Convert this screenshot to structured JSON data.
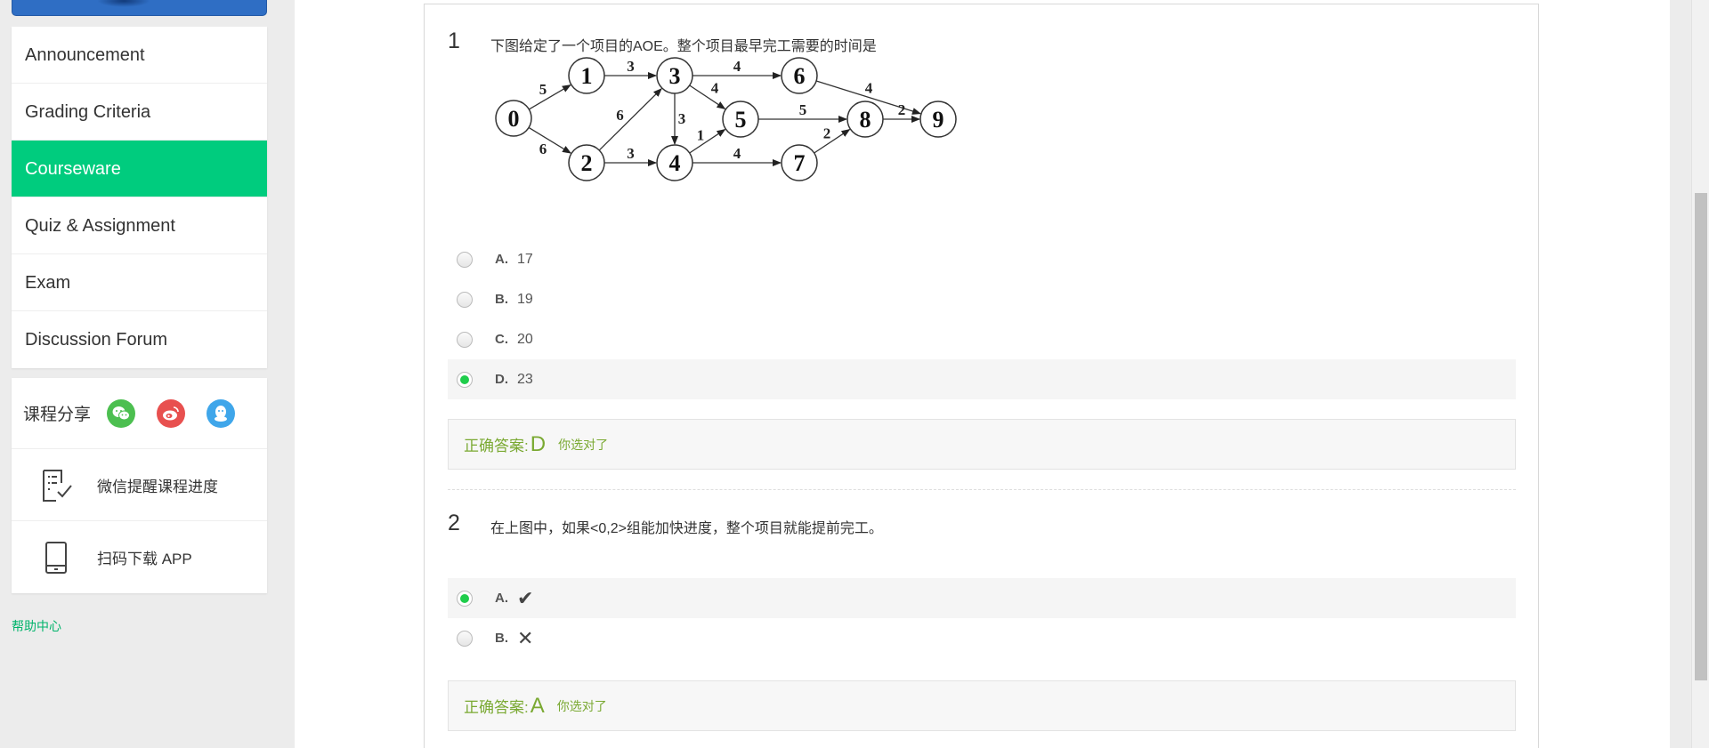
{
  "sidebar": {
    "nav": [
      {
        "label": "Announcement"
      },
      {
        "label": "Grading Criteria"
      },
      {
        "label": "Courseware",
        "active": true
      },
      {
        "label": "Quiz & Assignment"
      },
      {
        "label": "Exam"
      },
      {
        "label": "Discussion Forum"
      }
    ],
    "share": {
      "label": "课程分享",
      "buttons": [
        {
          "icon": "wechat-icon",
          "color": "#4cbf50"
        },
        {
          "icon": "weibo-icon",
          "color": "#e8504f"
        },
        {
          "icon": "qq-icon",
          "color": "#3fa6ea"
        }
      ]
    },
    "tools": [
      {
        "label": "微信提醒课程进度",
        "icon": "checklist-icon"
      },
      {
        "label": "扫码下载 APP",
        "icon": "phone-icon"
      }
    ],
    "help_link": "帮助中心"
  },
  "questions": [
    {
      "number": "1",
      "text": "下图给定了一个项目的AOE。整个项目最早完工需要的时间是",
      "diagram": {
        "nodes": [
          "0",
          "1",
          "2",
          "3",
          "4",
          "5",
          "6",
          "7",
          "8",
          "9"
        ],
        "edges": [
          {
            "from": "0",
            "to": "1",
            "weight": "5"
          },
          {
            "from": "0",
            "to": "2",
            "weight": "6"
          },
          {
            "from": "1",
            "to": "3",
            "weight": "3"
          },
          {
            "from": "2",
            "to": "3",
            "weight": "6"
          },
          {
            "from": "2",
            "to": "4",
            "weight": "3"
          },
          {
            "from": "3",
            "to": "4",
            "weight": "3"
          },
          {
            "from": "3",
            "to": "5",
            "weight": "4"
          },
          {
            "from": "3",
            "to": "6",
            "weight": "4"
          },
          {
            "from": "4",
            "to": "5",
            "weight": "1"
          },
          {
            "from": "4",
            "to": "7",
            "weight": "4"
          },
          {
            "from": "5",
            "to": "8",
            "weight": "5"
          },
          {
            "from": "6",
            "to": "9",
            "weight": "4"
          },
          {
            "from": "7",
            "to": "8",
            "weight": "2"
          },
          {
            "from": "8",
            "to": "9",
            "weight": "2"
          }
        ]
      },
      "options": [
        {
          "letter": "A.",
          "text": "17",
          "selected": false
        },
        {
          "letter": "B.",
          "text": "19",
          "selected": false
        },
        {
          "letter": "C.",
          "text": "20",
          "selected": false
        },
        {
          "letter": "D.",
          "text": "23",
          "selected": true
        }
      ],
      "answer": {
        "label": "正确答案:",
        "value": "D",
        "note": "你选对了"
      }
    },
    {
      "number": "2",
      "text": "在上图中，如果<0,2>组能加快进度，整个项目就能提前完工。",
      "options": [
        {
          "letter": "A.",
          "glyph": "✔",
          "icon": "check-icon",
          "selected": true
        },
        {
          "letter": "B.",
          "glyph": "✕",
          "icon": "cross-icon",
          "selected": false
        }
      ],
      "answer": {
        "label": "正确答案:",
        "value": "A",
        "note": "你选对了"
      }
    }
  ],
  "colors": {
    "accent": "#00cc7e",
    "answer_text": "#7aa932",
    "radio_checked": "#1fcd4b"
  }
}
